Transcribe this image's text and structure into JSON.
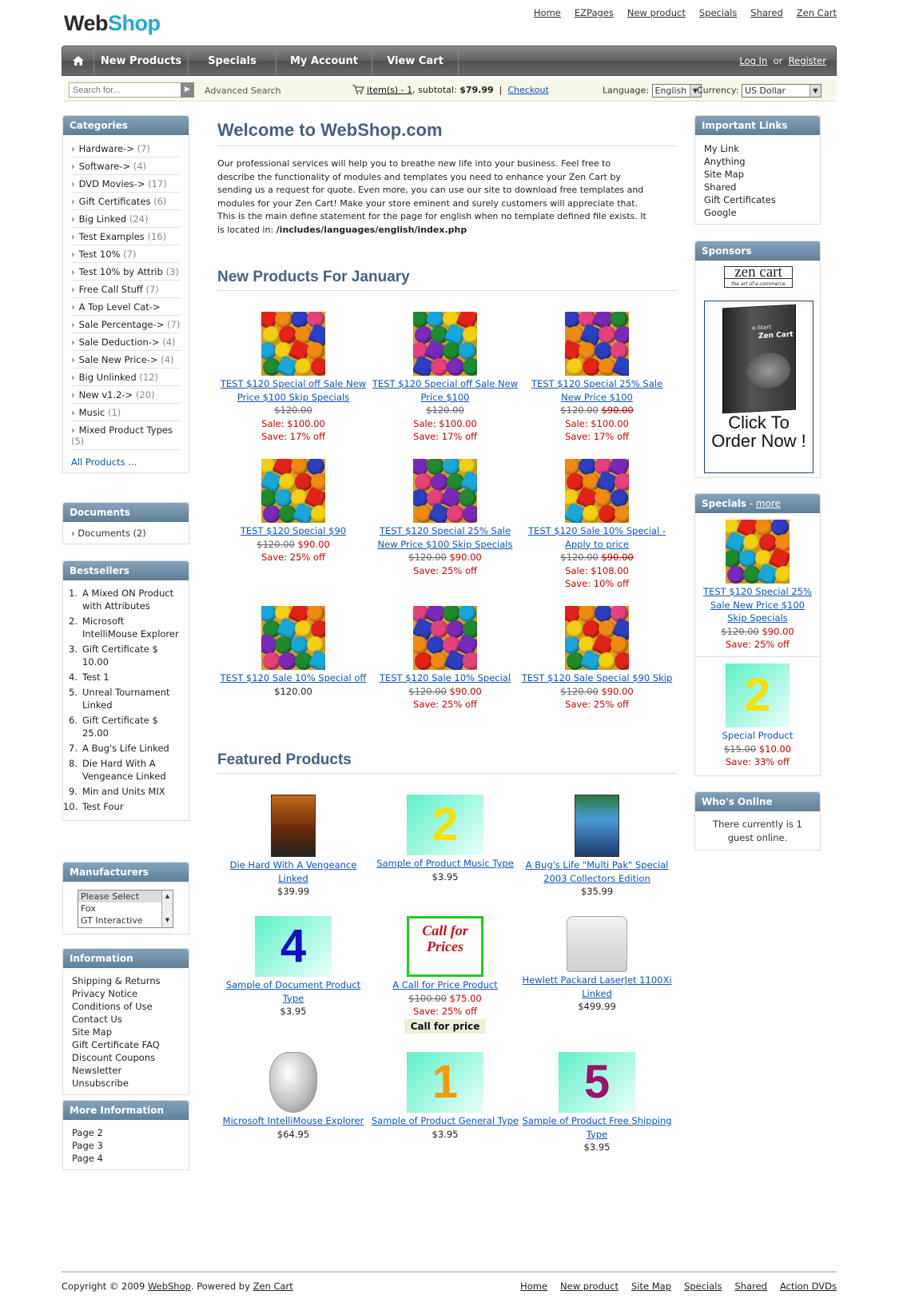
{
  "header": {
    "logo_part1": "Web",
    "logo_part2": "Shop",
    "top_links": [
      "Home",
      "EZPages",
      "New product",
      "Specials",
      "Shared",
      "Zen Cart"
    ]
  },
  "nav": {
    "tabs": [
      "New Products",
      "Specials",
      "My Account",
      "View Cart"
    ],
    "login": "Log In",
    "or": "or",
    "register": "Register"
  },
  "subbar": {
    "search_placeholder": "Search for...",
    "advanced_search": "Advanced Search",
    "cart_items": "item(s) - 1",
    "cart_subtotal_label": ", subtotal: ",
    "cart_subtotal": "$79.99",
    "sep": "|",
    "checkout": "Checkout",
    "language_label": "Language:",
    "language_value": "English",
    "currency_label": "Currency:",
    "currency_value": "US Dollar"
  },
  "categories": {
    "title": "Categories",
    "items": [
      {
        "name": "Hardware->",
        "count": "(7)"
      },
      {
        "name": "Software->",
        "count": "(4)"
      },
      {
        "name": "DVD Movies->",
        "count": "(17)"
      },
      {
        "name": "Gift Certificates",
        "count": "(6)"
      },
      {
        "name": "Big Linked",
        "count": "(24)"
      },
      {
        "name": "Test Examples",
        "count": "(16)"
      },
      {
        "name": "Test 10%",
        "count": "(7)"
      },
      {
        "name": "Test 10% by Attrib",
        "count": "(3)"
      },
      {
        "name": "Free Call Stuff",
        "count": "(7)"
      },
      {
        "name": "A Top Level Cat->",
        "count": ""
      },
      {
        "name": "Sale Percentage->",
        "count": "(7)"
      },
      {
        "name": "Sale Deduction->",
        "count": "(4)"
      },
      {
        "name": "Sale New Price->",
        "count": "(4)"
      },
      {
        "name": "Big Unlinked",
        "count": "(12)"
      },
      {
        "name": "New v1.2->",
        "count": "(20)"
      },
      {
        "name": "Music",
        "count": "(1)"
      },
      {
        "name": "Mixed Product Types",
        "count": "(5)"
      }
    ],
    "all_products": "All Products ..."
  },
  "documents": {
    "title": "Documents",
    "item": "Documents",
    "count": "(2)"
  },
  "bestsellers": {
    "title": "Bestsellers",
    "items": [
      "A Mixed ON Product with Attributes",
      "Microsoft IntelliMouse Explorer",
      "Gift Certificate $ 10.00",
      "Test 1",
      "Unreal Tournament Linked",
      "Gift Certificate $ 25.00",
      "A Bug's Life Linked",
      "Die Hard With A Vengeance Linked",
      "Min and Units MIX",
      "Test Four"
    ]
  },
  "manufacturers": {
    "title": "Manufacturers",
    "options": [
      "Please Select",
      "Fox",
      "GT Interactive"
    ]
  },
  "information": {
    "title": "Information",
    "items": [
      "Shipping & Returns",
      "Privacy Notice",
      "Conditions of Use",
      "Contact Us",
      "Site Map",
      "Gift Certificate FAQ",
      "Discount Coupons",
      "Newsletter Unsubscribe"
    ]
  },
  "more_info": {
    "title": "More Information",
    "items": [
      "Page 2",
      "Page 3",
      "Page 4"
    ]
  },
  "main": {
    "welcome_title": "Welcome to WebShop.com",
    "intro": "Our professional services will help you to breathe new life into your business. Feel free to describe the functionality of modules and templates you need to enhance your Zen Cart by sending us a request for quote. Even more, you can use our site to download free templates and modules for your Zen Cart! Make your store eminent and surely customers will appreciate that. This is the main define statement for the page for english when no template defined file exists. It is located in: ",
    "intro_path": "/includes/languages/english/index.php",
    "new_title": "New Products For January",
    "new_products": [
      {
        "name": "TEST $120 Special off Sale New Price $100 Skip Specials",
        "old": "$120.00",
        "old2": "",
        "price": "",
        "sale": "Sale: $100.00",
        "save": "Save: 17% off"
      },
      {
        "name": "TEST $120 Special off Sale New Price $100",
        "old": "$120.00",
        "old2": "",
        "price": "",
        "sale": "Sale: $100.00",
        "save": "Save: 17% off"
      },
      {
        "name": "TEST $120 Special 25% Sale New Price $100",
        "old": "$120.00",
        "old2": "$90.00",
        "price": "",
        "sale": "Sale: $100.00",
        "save": "Save: 17% off"
      },
      {
        "name": "TEST $120 Special $90",
        "old": "$120.00",
        "old2": "",
        "price": "$90.00",
        "sale": "",
        "save": "Save: 25% off"
      },
      {
        "name": "TEST $120 Special 25% Sale New Price $100 Skip Specials",
        "old": "$120.00",
        "old2": "",
        "price": "$90.00",
        "sale": "",
        "save": "Save: 25% off"
      },
      {
        "name": "TEST $120 Sale 10% Special - Apply to price",
        "old": "$120.00",
        "old2": "$90.00",
        "price": "",
        "sale": "Sale: $108.00",
        "save": "Save: 10% off"
      },
      {
        "name": "TEST $120 Sale 10% Special off",
        "old": "",
        "old2": "",
        "price": "$120.00",
        "sale": "",
        "save": ""
      },
      {
        "name": "TEST $120 Sale 10% Special",
        "old": "$120.00",
        "old2": "",
        "price": "$90.00",
        "sale": "",
        "save": "Save: 25% off"
      },
      {
        "name": "TEST $120 Sale Special $90 Skip",
        "old": "$120.00",
        "old2": "",
        "price": "$90.00",
        "sale": "",
        "save": "Save: 25% off"
      }
    ],
    "featured_title": "Featured Products",
    "featured": [
      {
        "name": "Die Hard With A Vengeance Linked",
        "old": "",
        "price": "$39.99",
        "save": "",
        "img": "dvd-diehard"
      },
      {
        "name": "Sample of Product Music Type",
        "old": "",
        "price": "$3.95",
        "save": "",
        "img": "num",
        "num": "2",
        "numcolor": "#f5e000"
      },
      {
        "name": "A Bug's Life \"Multi Pak\" Special 2003 Collectors Edition",
        "old": "",
        "price": "$35.99",
        "save": "",
        "img": "dvd-bugs"
      },
      {
        "name": "Sample of Document Product Type",
        "old": "",
        "price": "$3.95",
        "save": "",
        "img": "num",
        "num": "4",
        "numcolor": "#1010c0"
      },
      {
        "name": "A Call for Price Product",
        "old": "$100.00",
        "price": "$75.00",
        "save": "Save: 25% off",
        "img": "call",
        "call": "Call for Prices",
        "call_btn": "Call for price"
      },
      {
        "name": "Hewlett Packard LaserJet 1100Xi Linked",
        "old": "",
        "price": "$499.99",
        "save": "",
        "img": "printer"
      },
      {
        "name": "Microsoft IntelliMouse Explorer",
        "old": "",
        "price": "$64.95",
        "save": "",
        "img": "mouse"
      },
      {
        "name": "Sample of Product General Type",
        "old": "",
        "price": "$3.95",
        "save": "",
        "img": "num",
        "num": "1",
        "numcolor": "#f59a00"
      },
      {
        "name": "Sample of Product Free Shipping Type",
        "old": "",
        "price": "$3.95",
        "save": "",
        "img": "num",
        "num": "5",
        "numcolor": "#a0106a"
      }
    ]
  },
  "important_links": {
    "title": "Important Links",
    "items": [
      "My Link",
      "Anything",
      "Site Map",
      "Shared",
      "Gift Certificates",
      "Google"
    ]
  },
  "sponsors": {
    "title": "Sponsors",
    "zc_logo": "zen cart",
    "zc_tag": "the art of e-commerce",
    "box_text": "Click To Order Now !",
    "box_brand": "Zen Cart",
    "box_small": "e-Start"
  },
  "specials": {
    "title": "Specials",
    "dash": " - ",
    "more": "more",
    "items": [
      {
        "name": "TEST $120 Special 25% Sale New Price $100 Skip Specials",
        "old": "$120.00",
        "price": "$90.00",
        "save": "Save: 25% off"
      },
      {
        "name": "Special Product",
        "old": "$15.00",
        "price": "$10.00",
        "save": "Save: 33% off",
        "num": "2"
      }
    ]
  },
  "whos_online": {
    "title": "Who's Online",
    "text": "There currently is 1 guest online."
  },
  "footer": {
    "copyright": "Copyright © 2009 ",
    "shop": "WebShop",
    "powered": ". Powered by ",
    "zencart": "Zen Cart",
    "links": [
      "Home",
      "New product",
      "Site Map",
      "Specials",
      "Shared",
      "Action DVDs"
    ]
  }
}
